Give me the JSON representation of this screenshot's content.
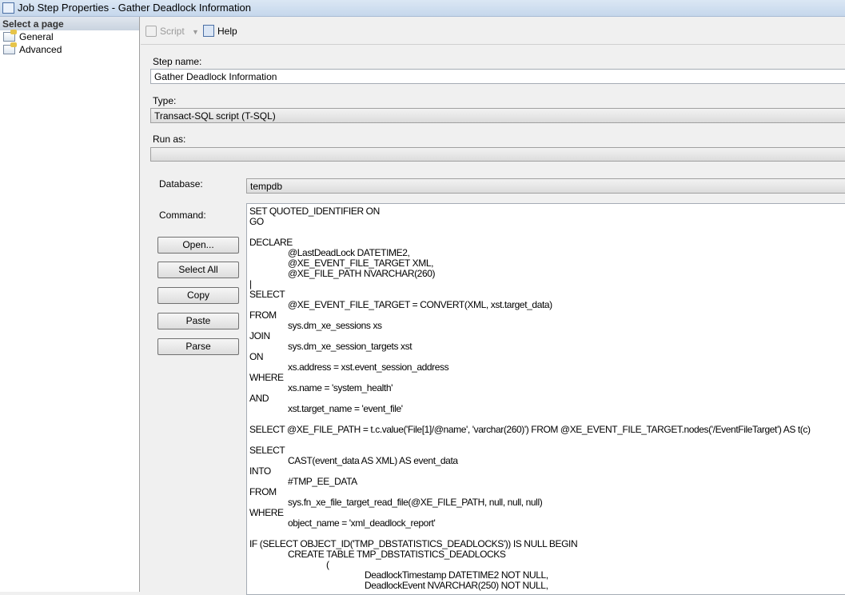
{
  "window": {
    "title": "Job Step Properties - Gather Deadlock Information"
  },
  "sidebar": {
    "header": "Select a page",
    "items": [
      {
        "label": "General"
      },
      {
        "label": "Advanced"
      }
    ]
  },
  "toolbar": {
    "script_label": "Script",
    "help_label": "Help"
  },
  "form": {
    "step_name_label": "Step name:",
    "step_name_value": "Gather Deadlock Information",
    "type_label": "Type:",
    "type_value": "Transact-SQL script (T-SQL)",
    "run_as_label": "Run as:",
    "run_as_value": "",
    "database_label": "Database:",
    "database_value": "tempdb",
    "command_label": "Command:"
  },
  "buttons": {
    "open": "Open...",
    "select_all": "Select All",
    "copy": "Copy",
    "paste": "Paste",
    "parse": "Parse"
  },
  "command_lines": [
    {
      "i": 0,
      "t": "SET QUOTED_IDENTIFIER ON"
    },
    {
      "i": 0,
      "t": "GO"
    },
    {
      "i": 0,
      "t": ""
    },
    {
      "i": 0,
      "t": "DECLARE"
    },
    {
      "i": 1,
      "t": "@LastDeadLock DATETIME2,"
    },
    {
      "i": 1,
      "t": "@XE_EVENT_FILE_TARGET XML,"
    },
    {
      "i": 1,
      "t": "@XE_FILE_PATH NVARCHAR(260)"
    },
    {
      "i": 0,
      "t": "|"
    },
    {
      "i": 0,
      "t": "SELECT"
    },
    {
      "i": 1,
      "t": "@XE_EVENT_FILE_TARGET = CONVERT(XML, xst.target_data)"
    },
    {
      "i": 0,
      "t": "FROM"
    },
    {
      "i": 1,
      "t": "sys.dm_xe_sessions xs"
    },
    {
      "i": 0,
      "t": "JOIN"
    },
    {
      "i": 1,
      "t": "sys.dm_xe_session_targets xst"
    },
    {
      "i": 0,
      "t": "ON"
    },
    {
      "i": 1,
      "t": "xs.address = xst.event_session_address"
    },
    {
      "i": 0,
      "t": "WHERE"
    },
    {
      "i": 1,
      "t": "xs.name = 'system_health'"
    },
    {
      "i": 0,
      "t": "AND"
    },
    {
      "i": 1,
      "t": "xst.target_name = 'event_file'"
    },
    {
      "i": 0,
      "t": ""
    },
    {
      "i": 0,
      "t": "SELECT @XE_FILE_PATH = t.c.value('File[1]/@name', 'varchar(260)') FROM @XE_EVENT_FILE_TARGET.nodes('/EventFileTarget') AS t(c)"
    },
    {
      "i": 0,
      "t": ""
    },
    {
      "i": 0,
      "t": "SELECT"
    },
    {
      "i": 1,
      "t": "CAST(event_data AS XML) AS event_data"
    },
    {
      "i": 0,
      "t": "INTO"
    },
    {
      "i": 1,
      "t": "#TMP_EE_DATA"
    },
    {
      "i": 0,
      "t": "FROM"
    },
    {
      "i": 1,
      "t": "sys.fn_xe_file_target_read_file(@XE_FILE_PATH, null, null, null)"
    },
    {
      "i": 0,
      "t": "WHERE"
    },
    {
      "i": 1,
      "t": "object_name = 'xml_deadlock_report'"
    },
    {
      "i": 0,
      "t": ""
    },
    {
      "i": 0,
      "t": "IF (SELECT OBJECT_ID('TMP_DBSTATISTICS_DEADLOCKS')) IS NULL BEGIN"
    },
    {
      "i": 1,
      "t": "CREATE TABLE TMP_DBSTATISTICS_DEADLOCKS"
    },
    {
      "i": 2,
      "t": "("
    },
    {
      "i": 3,
      "t": "DeadlockTimestamp DATETIME2 NOT NULL,"
    },
    {
      "i": 3,
      "t": "DeadlockEvent NVARCHAR(250) NOT NULL,"
    }
  ]
}
